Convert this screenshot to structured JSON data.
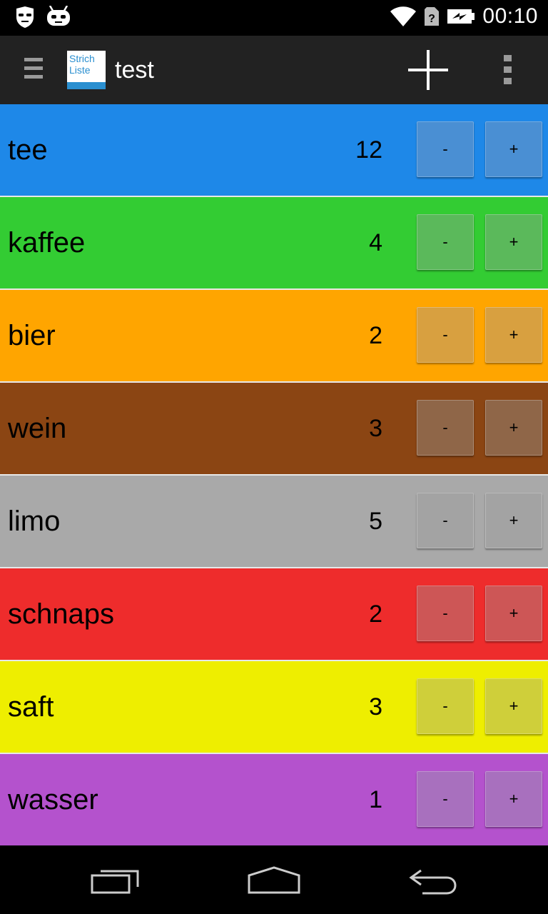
{
  "status_bar": {
    "time": "00:10",
    "left_icons": [
      "incognito-icon",
      "cyanogenmod-android-icon"
    ],
    "right_icons": [
      "wifi-icon",
      "no-sim-icon",
      "battery-charging-icon"
    ]
  },
  "action_bar": {
    "logo_text_line1": "Strich",
    "logo_text_line2": "Liste",
    "title": "test",
    "actions": [
      "add-icon",
      "overflow-menu-icon"
    ]
  },
  "counters": [
    {
      "name": "tee",
      "count": "12",
      "color": "#1E88E8",
      "button_color": "#4A8FD3",
      "minus_label": "-",
      "plus_label": "+"
    },
    {
      "name": "kaffee",
      "count": "4",
      "color": "#33CC33",
      "button_color": "#5BB95B",
      "minus_label": "-",
      "plus_label": "+"
    },
    {
      "name": "bier",
      "count": "2",
      "color": "#FFA500",
      "button_color": "#D8A040",
      "minus_label": "-",
      "plus_label": "+"
    },
    {
      "name": "wein",
      "count": "3",
      "color": "#8B4513",
      "button_color": "#8F6648",
      "minus_label": "-",
      "plus_label": "+"
    },
    {
      "name": "limo",
      "count": "5",
      "color": "#A9A9A9",
      "button_color": "#A3A3A3",
      "minus_label": "-",
      "plus_label": "+"
    },
    {
      "name": "schnaps",
      "count": "2",
      "color": "#EE2C2C",
      "button_color": "#CD5656",
      "minus_label": "-",
      "plus_label": "+"
    },
    {
      "name": "saft",
      "count": "3",
      "color": "#EEEE00",
      "button_color": "#CFCF3A",
      "minus_label": "-",
      "plus_label": "+"
    },
    {
      "name": "wasser",
      "count": "1",
      "color": "#B452CD",
      "button_color": "#A870BE",
      "minus_label": "-",
      "plus_label": "+"
    }
  ],
  "nav_bar": {
    "buttons": [
      "recent-apps-icon",
      "home-icon",
      "back-icon"
    ]
  }
}
